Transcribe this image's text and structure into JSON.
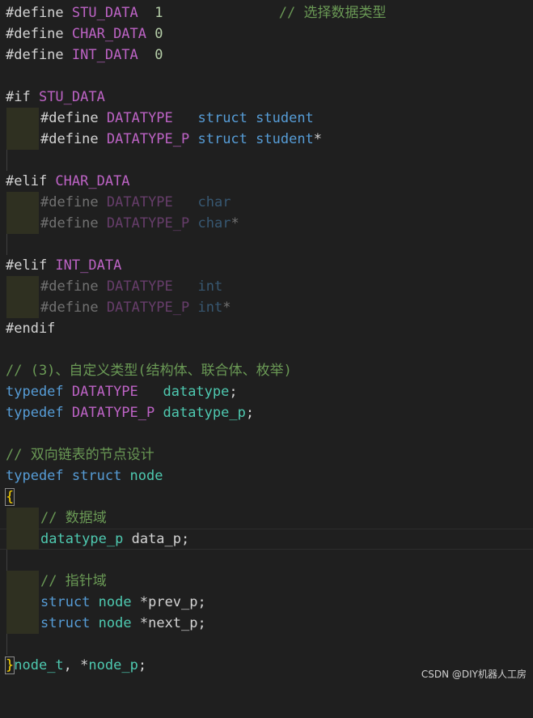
{
  "lines": {
    "l1": {
      "a": "#define ",
      "b": "STU_DATA",
      "c": "  1",
      "d": "              // 选择数据类型"
    },
    "l2": {
      "a": "#define ",
      "b": "CHAR_DATA",
      "c": " 0"
    },
    "l3": {
      "a": "#define ",
      "b": "INT_DATA",
      "c": "  0"
    },
    "l5": {
      "a": "#if ",
      "b": "STU_DATA"
    },
    "l6": {
      "a": "#define ",
      "b": "DATATYPE",
      "c": "   struct",
      "d": " student"
    },
    "l7": {
      "a": "#define ",
      "b": "DATATYPE_P",
      "c": " struct",
      "d": " student",
      "e": "*"
    },
    "l9": {
      "a": "#elif ",
      "b": "CHAR_DATA"
    },
    "l10": {
      "a": "#define ",
      "b": "DATATYPE",
      "c": "   char"
    },
    "l11": {
      "a": "#define ",
      "b": "DATATYPE_P",
      "c": " char",
      "d": "*"
    },
    "l13": {
      "a": "#elif ",
      "b": "INT_DATA"
    },
    "l14": {
      "a": "#define ",
      "b": "DATATYPE",
      "c": "   int"
    },
    "l15": {
      "a": "#define ",
      "b": "DATATYPE_P",
      "c": " int",
      "d": "*"
    },
    "l16": {
      "a": "#endif"
    },
    "l18": {
      "a": "// (3)、自定义类型(结构体、联合体、枚举)"
    },
    "l19": {
      "a": "typedef ",
      "b": "DATATYPE",
      "c": "   datatype",
      "d": ";"
    },
    "l20": {
      "a": "typedef ",
      "b": "DATATYPE_P",
      "c": " datatype_p",
      "d": ";"
    },
    "l22": {
      "a": "// 双向链表的节点设计"
    },
    "l23": {
      "a": "typedef ",
      "b": "struct ",
      "c": "node"
    },
    "l24": {
      "a": "{"
    },
    "l25": {
      "a": "// 数据域"
    },
    "l26": {
      "a": "datatype_p",
      "b": " data_p",
      "c": ";"
    },
    "l28": {
      "a": "// 指针域"
    },
    "l29": {
      "a": "struct ",
      "b": "node",
      "c": " *",
      "d": "prev_p",
      "e": ";"
    },
    "l30": {
      "a": "struct ",
      "b": "node",
      "c": " *",
      "d": "next_p",
      "e": ";"
    },
    "l32": {
      "a": "}",
      "b": "node_t",
      "c": ", *",
      "d": "node_p",
      "e": ";"
    }
  },
  "watermark": "CSDN @DIY机器人工房",
  "colors": {
    "background": "#1f1f1f",
    "preprocessor": "#c586c0",
    "macro": "#bd63c5",
    "number": "#b5cea8",
    "comment": "#6a9955",
    "keyword_type": "#569cd6",
    "identifier": "#4ec9b0",
    "variable": "#9cdcfe",
    "brace": "#ffd700"
  }
}
